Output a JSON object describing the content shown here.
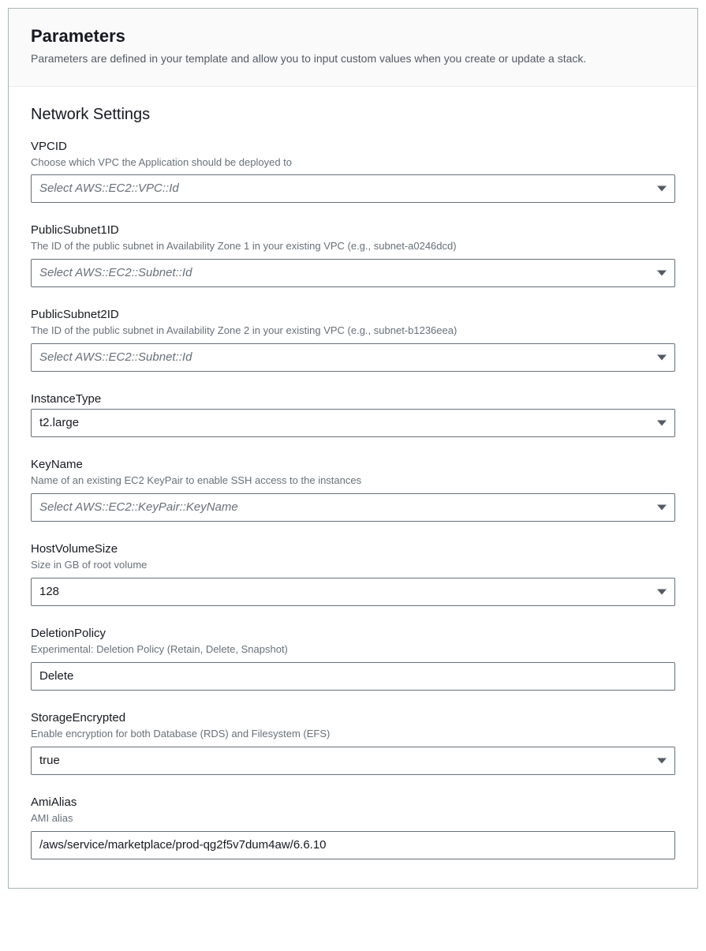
{
  "header": {
    "title": "Parameters",
    "description": "Parameters are defined in your template and allow you to input custom values when you create or update a stack."
  },
  "section": {
    "title": "Network Settings"
  },
  "fields": {
    "vpcid": {
      "label": "VPCID",
      "description": "Choose which VPC the Application should be deployed to",
      "placeholder": "Select AWS::EC2::VPC::Id"
    },
    "publicsubnet1id": {
      "label": "PublicSubnet1ID",
      "description": "The ID of the public subnet in Availability Zone 1 in your existing VPC (e.g., subnet-a0246dcd)",
      "placeholder": "Select AWS::EC2::Subnet::Id"
    },
    "publicsubnet2id": {
      "label": "PublicSubnet2ID",
      "description": "The ID of the public subnet in Availability Zone 2 in your existing VPC (e.g., subnet-b1236eea)",
      "placeholder": "Select AWS::EC2::Subnet::Id"
    },
    "instancetype": {
      "label": "InstanceType",
      "value": "t2.large"
    },
    "keyname": {
      "label": "KeyName",
      "description": "Name of an existing EC2 KeyPair to enable SSH access to the instances",
      "placeholder": "Select AWS::EC2::KeyPair::KeyName"
    },
    "hostvolumesize": {
      "label": "HostVolumeSize",
      "description": "Size in GB of root volume",
      "value": "128"
    },
    "deletionpolicy": {
      "label": "DeletionPolicy",
      "description": "Experimental: Deletion Policy (Retain, Delete, Snapshot)",
      "value": "Delete"
    },
    "storageencrypted": {
      "label": "StorageEncrypted",
      "description": "Enable encryption for both Database (RDS) and Filesystem (EFS)",
      "value": "true"
    },
    "amialias": {
      "label": "AmiAlias",
      "description": "AMI alias",
      "value": "/aws/service/marketplace/prod-qg2f5v7dum4aw/6.6.10"
    }
  }
}
